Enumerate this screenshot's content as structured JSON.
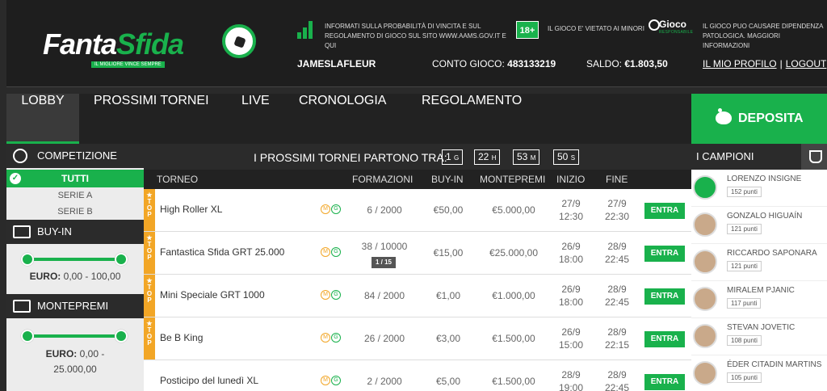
{
  "header": {
    "logo_text_1": "Fanta",
    "logo_text_2": "Sfida",
    "logo_tagline": "IL MIGLIORE VINCE SEMPRE",
    "info_prob": "INFORMATI SULLA PROBABILITÀ DI VINCITA E SUL REGOLAMENTO DI GIOCO SUL SITO WWW.AAMS.GOV.IT E QUI",
    "badge_18": "18+",
    "info_minors": "IL GIOCO E' VIETATO AI MINORI",
    "gioco_title": "Gioco",
    "gioco_sub": "RESPONSABILE",
    "info_dependency": "IL GIOCO PUO CAUSARE DIPENDENZA PATOLOGICA. MAGGIORI INFORMAZIONI",
    "username": "JAMESLAFLEUR",
    "conto_label": "CONTO GIOCO:",
    "conto_value": "483133219",
    "saldo_label": "SALDO:",
    "saldo_value": "€1.803,50",
    "profile_link": "IL MIO PROFILO",
    "separator": "|",
    "logout_link": "LOGOUT"
  },
  "nav": {
    "items": [
      "LOBBY",
      "PROSSIMI TORNEI",
      "LIVE",
      "CRONOLOGIA",
      "REGOLAMENTO"
    ],
    "active": "LOBBY",
    "deposit": "DEPOSITA"
  },
  "sidebar": {
    "competizione": "COMPETIZIONE",
    "tutti": "TUTTI",
    "serie_a": "SERIE A",
    "serie_b": "SERIE B",
    "buyin": "BUY-IN",
    "buyin_label": "EURO:",
    "buyin_range": "0,00 - 100,00",
    "montepremi": "MONTEPREMI",
    "mp_label": "EURO:",
    "mp_range_1": "0,00 -",
    "mp_range_2": "25.000,00"
  },
  "countdown": {
    "label": "I PROSSIMI TORNEI PARTONO TRA:",
    "days": "1",
    "days_unit": "G",
    "hours": "22",
    "hours_unit": "H",
    "minutes": "53",
    "minutes_unit": "M",
    "seconds": "50",
    "seconds_unit": "S"
  },
  "table": {
    "columns": [
      "TORNEO",
      "FORMAZIONI",
      "BUY-IN",
      "MONTEPREMI",
      "INIZIO",
      "FINE"
    ],
    "top_label": "TOP",
    "mg_m": "M",
    "mg_g": "G",
    "action": "ENTRA",
    "rows": [
      {
        "name": "High Roller XL",
        "top": true,
        "formazioni": "6 / 2000",
        "buyin": "€50,00",
        "montepremi": "€5.000,00",
        "inizio_d": "27/9",
        "inizio_t": "12:30",
        "fine_d": "27/9",
        "fine_t": "22:30",
        "sub": ""
      },
      {
        "name": "Fantastica Sfida GRT 25.000",
        "top": true,
        "formazioni": "38 / 10000",
        "buyin": "€15,00",
        "montepremi": "€25.000,00",
        "inizio_d": "26/9",
        "inizio_t": "18:00",
        "fine_d": "28/9",
        "fine_t": "22:45",
        "sub": "1 / 15"
      },
      {
        "name": "Mini Speciale GRT 1000",
        "top": true,
        "formazioni": "84 / 2000",
        "buyin": "€1,00",
        "montepremi": "€1.000,00",
        "inizio_d": "26/9",
        "inizio_t": "18:00",
        "fine_d": "28/9",
        "fine_t": "22:45",
        "sub": ""
      },
      {
        "name": "Be B King",
        "top": true,
        "formazioni": "26 / 2000",
        "buyin": "€3,00",
        "montepremi": "€1.500,00",
        "inizio_d": "26/9",
        "inizio_t": "15:00",
        "fine_d": "28/9",
        "fine_t": "22:15",
        "sub": ""
      },
      {
        "name": "Posticipo del lunedì XL",
        "top": false,
        "formazioni": "2 / 2000",
        "buyin": "€5,00",
        "montepremi": "€1.500,00",
        "inizio_d": "28/9",
        "inizio_t": "19:00",
        "fine_d": "28/9",
        "fine_t": "22:45",
        "sub": ""
      }
    ]
  },
  "champions": {
    "title": "I CAMPIONI",
    "list": [
      {
        "name": "LORENZO INSIGNE",
        "points": "152 punti"
      },
      {
        "name": "GONZALO HIGUAÍN",
        "points": "121 punti"
      },
      {
        "name": "RICCARDO SAPONARA",
        "points": "121 punti"
      },
      {
        "name": "MIRALEM PJANIC",
        "points": "117 punti"
      },
      {
        "name": "STEVAN JOVETIC",
        "points": "108 punti"
      },
      {
        "name": "ÉDER CITADIN MARTINS",
        "points": "105 punti"
      }
    ]
  },
  "colors": {
    "accent": "#19b14c",
    "top_badge": "#f2a626",
    "dark": "#222222"
  }
}
